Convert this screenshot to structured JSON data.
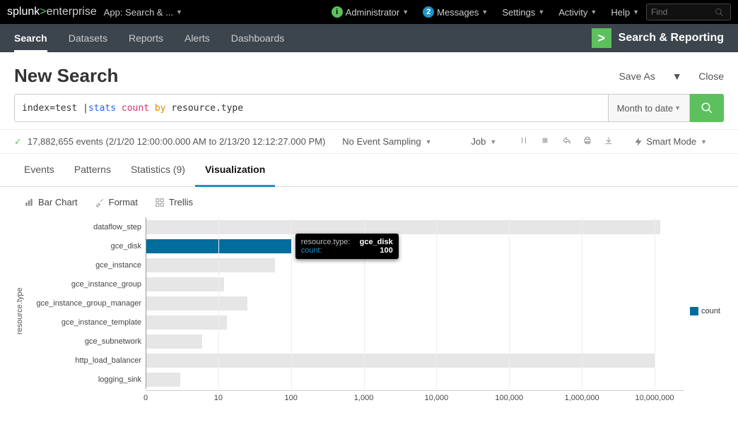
{
  "top": {
    "brand_prefix": "splunk",
    "brand_suffix": "enterprise",
    "app_label": "App: Search & ...",
    "administrator": "Administrator",
    "messages_count": "2",
    "messages": "Messages",
    "settings": "Settings",
    "activity": "Activity",
    "help": "Help",
    "find_placeholder": "Find"
  },
  "nav": {
    "items": [
      "Search",
      "Datasets",
      "Reports",
      "Alerts",
      "Dashboards"
    ],
    "sr_label": "Search & Reporting"
  },
  "header": {
    "title": "New Search",
    "save_as": "Save As",
    "close": "Close"
  },
  "search": {
    "prefix": "index=test | ",
    "cmd": "stats",
    "func": "count",
    "by": "by",
    "field": "resource.type",
    "time_range": "Month to date"
  },
  "status": {
    "event_text": "17,882,655 events (2/1/20 12:00:00.000 AM to 2/13/20 12:12:27.000 PM)",
    "sampling": "No Event Sampling",
    "job": "Job",
    "smart": "Smart Mode"
  },
  "tabs": {
    "events": "Events",
    "patterns": "Patterns",
    "statistics": "Statistics (9)",
    "visualization": "Visualization"
  },
  "viztb": {
    "bar": "Bar Chart",
    "format": "Format",
    "trellis": "Trellis"
  },
  "chart_data": {
    "type": "bar",
    "orientation": "horizontal",
    "xscale": "log",
    "xlabel": "",
    "ylabel": "resource.type",
    "legend": "count",
    "xticks": [
      "0",
      "10",
      "100",
      "1,000",
      "10,000",
      "100,000",
      "1,000,000",
      "10,000,000"
    ],
    "categories": [
      "dataflow_step",
      "gce_disk",
      "gce_instance",
      "gce_instance_group",
      "gce_instance_group_manager",
      "gce_instance_template",
      "gce_subnetwork",
      "http_load_balancer",
      "logging_sink"
    ],
    "values": [
      12000000,
      100,
      60,
      12,
      25,
      13,
      6,
      10000000,
      3
    ],
    "highlight_index": 1,
    "tooltip": {
      "key1": "resource.type:",
      "val1": "gce_disk",
      "key2": "count:",
      "val2": "100"
    }
  }
}
